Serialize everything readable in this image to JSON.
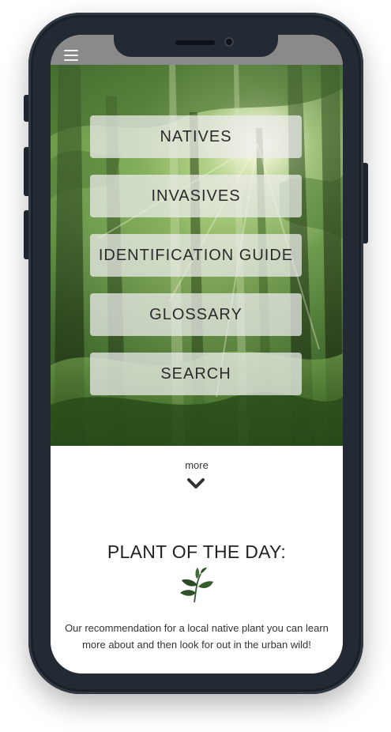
{
  "nav": {
    "buttons": [
      {
        "label": "NATIVES"
      },
      {
        "label": "INVASIVES"
      },
      {
        "label": "IDENTIFICATION GUIDE"
      },
      {
        "label": "GLOSSARY"
      },
      {
        "label": "SEARCH"
      }
    ]
  },
  "more": {
    "label": "more",
    "icon": "chevron-down-icon"
  },
  "plant_of_the_day": {
    "title": "PLANT OF THE DAY:",
    "icon": "leaf-sprig-icon",
    "description": "Our recommendation for a local native plant you can learn more about and then look for out in the urban wild!"
  },
  "icons": {
    "menu": "hamburger-menu-icon"
  },
  "colors": {
    "frame": "#232a33",
    "status_bar": "#8a8a8a",
    "button_bg": "#ececec",
    "text": "#2b2b2b"
  }
}
